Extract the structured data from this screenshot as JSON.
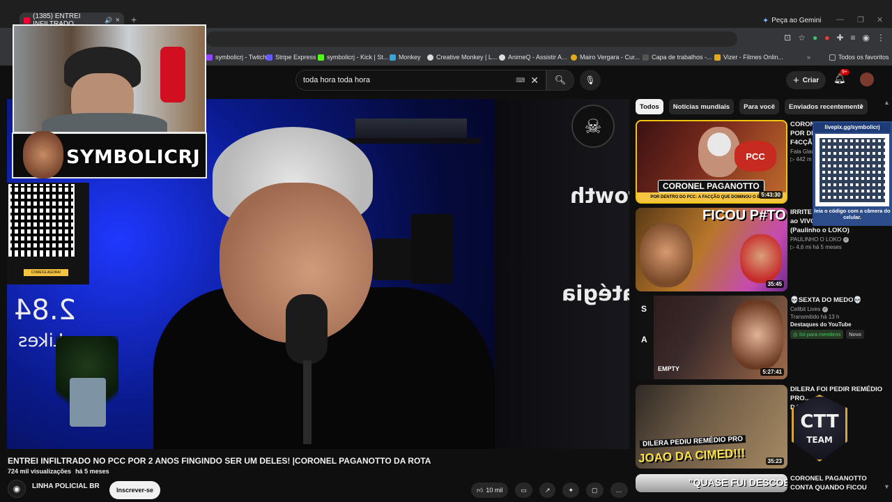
{
  "browser": {
    "tab_title": "(1385) ENTREI INFILTRADO",
    "gemini_label": "Peça ao Gemini",
    "bookmarks": [
      {
        "label": "symbolicrj - Twitch",
        "color": "#9146ff"
      },
      {
        "label": "Stripe Express",
        "color": "#635bff"
      },
      {
        "label": "symbolicrj - Kick | St...",
        "color": "#53fc18"
      },
      {
        "label": "Monkey",
        "color": "#36a3d9"
      },
      {
        "label": "Creative Monkey | L...",
        "color": "#dddddd"
      },
      {
        "label": "AnimeQ - Assistir A...",
        "color": "#dddddd"
      },
      {
        "label": "Mairo Vergara - Cur...",
        "color": "#e6a817"
      },
      {
        "label": "Capa de trabalhos -...",
        "color": "#555555"
      },
      {
        "label": "Vizer - Filmes Onlin...",
        "color": "#e6a817"
      },
      {
        "label": "Todos os favoritos",
        "color": "#aaaaaa"
      }
    ]
  },
  "header": {
    "search_value": "toda hora toda hora",
    "create_label": "Criar",
    "notifications_badge": "9+"
  },
  "overlay": {
    "streamer_name": "SYMBOLICRJ",
    "qr_left_button": "COMECE AGORA!",
    "qr_right_header": "livepix.gg/symbolicrj",
    "qr_right_footer": "leia o código com a câmera do celular.",
    "ctt_big": "CTT",
    "ctt_small": "TEAM"
  },
  "player": {
    "mirror_text_1": "rowth",
    "mirror_text_2": "stratégia",
    "mirror_likes_num": "2.84",
    "mirror_likes_label": "Likes"
  },
  "video": {
    "title": "ENTREI INFILTRADO NO PCC POR 2 ANOS FINGINDO SER UM DELES! |CORONEL PAGANOTTO DA ROTA",
    "views": "724 mil visualizações",
    "age": "há 5 meses",
    "channel": "LINHA POLICIAL BR",
    "subscribe_label": "Inscrever-se",
    "likes": "10 mil"
  },
  "chips": [
    "Todos",
    "Notícias mundiais",
    "Para você",
    "Enviados recentemente"
  ],
  "recommendations": [
    {
      "title": "CORONEL PAGANOTTO: POR DENTRO DO PCC A FACÇÃO",
      "title_lines": [
        "CORON",
        "POR DE",
        "F4CÇÃ"
      ],
      "channel": "Fala Glau",
      "meta": "▷ 442 m",
      "duration": "5:43:30",
      "thumb_caption": "CORONEL PAGANOTTO",
      "thumb_sub": "POR DENTRO DO PCC: A FACÇÃO QUE DOMINOU O BRASIL",
      "thumb_tag": "PCC"
    },
    {
      "title_lines": [
        "IRRITE",
        "ao VIVO",
        "(Paulinho o LOKO)"
      ],
      "channel": "PAULINHO O LOKO",
      "meta": "▷ 4,6 mi  há 5 meses",
      "duration": "35:45",
      "thumb_caption": "FICOU P#TO"
    },
    {
      "title_lines": [
        "💀SEXTA DO MEDO💀"
      ],
      "channel": "Cellbit Lives",
      "meta": "Transmitido há 13 h",
      "highlight": "Destaques do YouTube",
      "members_badge": "◎ Só para membros",
      "new_badge": "Novo",
      "duration": "5:27:41",
      "thumb_letters": [
        "S",
        "A"
      ],
      "thumb_caption": "EMPTY"
    },
    {
      "title_lines": [
        "DILERA FOI PEDIR REMÉDIO",
        "PRO...",
        "DA CIMED"
      ],
      "duration": "35:23",
      "thumb_caption": "DILERA PEDIU REMÉDIO PRO",
      "thumb_caption2": "JOAO DA CIMED!!!"
    },
    {
      "title_lines": [
        "CORONEL PAGANOTTO",
        "CONTA QUANDO FICOU"
      ],
      "thumb_caption": "\"QUASE FUI DESCOBERTO"
    }
  ]
}
